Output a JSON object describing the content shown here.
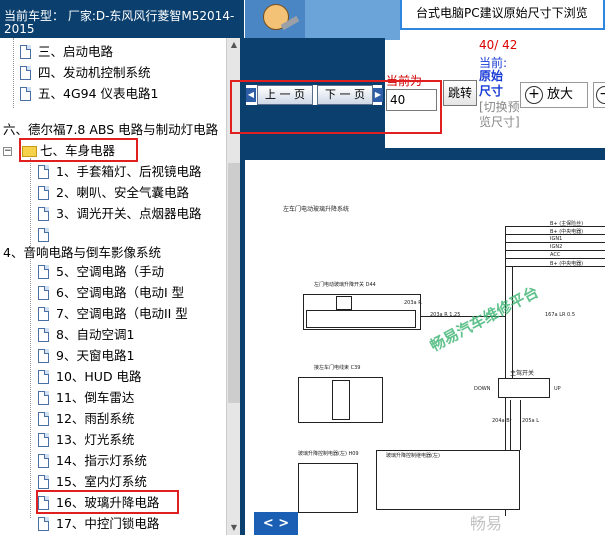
{
  "header": {
    "vehicle_title": "当前车型： 厂家:D-东风风行菱智M52014-2015"
  },
  "banner": {
    "text": "台式电脑PC建议原始尺寸下浏览"
  },
  "tree": {
    "items": [
      {
        "label": "三、启动电路",
        "kind": "page"
      },
      {
        "label": "四、发动机控制系统",
        "kind": "page"
      },
      {
        "label": "五、4G94 仪表电路1",
        "kind": "page"
      },
      {
        "label": "六、德尔福7.8 ABS 电路与制动灯电路",
        "kind": "text"
      },
      {
        "label": "七、车身电器",
        "kind": "folder"
      },
      {
        "label": "1、手套箱灯、后视镜电路",
        "kind": "page"
      },
      {
        "label": "2、喇叭、安全气囊电路",
        "kind": "page"
      },
      {
        "label": "3、调光开关、点烟器电路",
        "kind": "page"
      },
      {
        "label": "",
        "kind": "page"
      },
      {
        "label": "4、音响电路与倒车影像系统",
        "kind": "text"
      },
      {
        "label": "5、空调电路（手动",
        "kind": "page"
      },
      {
        "label": "6、空调电路（电动I 型",
        "kind": "page"
      },
      {
        "label": "7、空调电路（电动II 型",
        "kind": "page"
      },
      {
        "label": "8、自动空调1",
        "kind": "page"
      },
      {
        "label": "9、天窗电路1",
        "kind": "page"
      },
      {
        "label": "10、HUD 电路",
        "kind": "page"
      },
      {
        "label": "11、倒车雷达",
        "kind": "page"
      },
      {
        "label": "12、雨刮系统",
        "kind": "page"
      },
      {
        "label": "13、灯光系统",
        "kind": "page"
      },
      {
        "label": "14、指示灯系统",
        "kind": "page"
      },
      {
        "label": "15、室内灯系统",
        "kind": "page"
      },
      {
        "label": "16、玻璃升降电路",
        "kind": "page"
      },
      {
        "label": "17、中控门锁电路",
        "kind": "page"
      }
    ]
  },
  "toolbar": {
    "prev_label": "上 一 页",
    "next_label": "下 一 页",
    "current_page_label": "当前为",
    "page_input_value": "40",
    "jump_label": "跳转",
    "page_count": "40/ 42",
    "current_label": "当前:",
    "original_size_label": "原始尺寸",
    "toggle_preview_label": "[切换预览尺寸]",
    "zoom_in_label": "放大"
  },
  "diagram": {
    "title": "左车门电动玻璃升降系统",
    "bus_labels": [
      "B+ (主保险丝)",
      "B+ (中央电器)",
      "IGN1",
      "IGN2",
      "ACC",
      "B+ (中央电器)"
    ],
    "connector_D44": "左门电动玻璃升降开关 D44",
    "connector_C39": "接左车门电线束 C39",
    "connector_H09": "玻璃升降控制电器(左) H09",
    "relay_label": "玻璃升降控制继电器(左)",
    "switch_label": "主驾开关",
    "down_label": "DOWN",
    "up_label": "UP",
    "watermark": "畅易汽车维修平台",
    "wire_labels": [
      "203a R 1.25",
      "167a LR 0.5",
      "203a R",
      "204a Br",
      "205a L"
    ]
  },
  "bottom": {
    "nav_label": "< >",
    "logo_text": "畅易"
  },
  "colors": {
    "header_bg": "#0a3f6e",
    "highlight": "#e02020",
    "page_count": "#d00",
    "link_blue": "#1a3bd6"
  }
}
